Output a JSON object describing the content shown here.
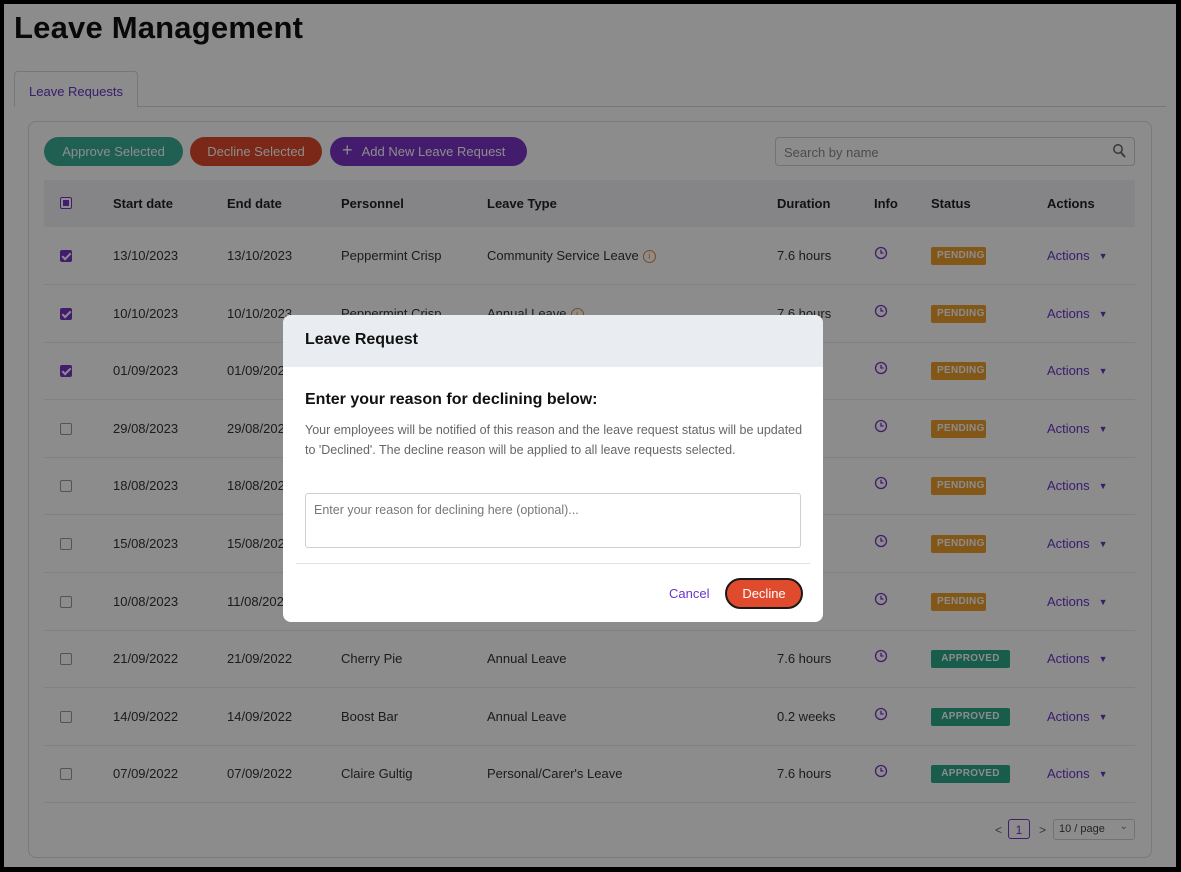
{
  "page": {
    "title": "Leave Management"
  },
  "tabs": [
    {
      "label": "Leave Requests"
    }
  ],
  "toolbar": {
    "approve_label": "Approve Selected",
    "decline_label": "Decline Selected",
    "add_label": "Add New Leave Request",
    "add_icon": "plus-icon",
    "search_placeholder": "Search by name",
    "search_icon": "search-icon"
  },
  "table": {
    "columns": [
      "Start date",
      "End date",
      "Personnel",
      "Leave Type",
      "Duration",
      "Info",
      "Status",
      "Actions"
    ],
    "rows": [
      {
        "checked": true,
        "start": "13/10/2023",
        "end": "13/10/2023",
        "personnel": "Peppermint Crisp",
        "type": "Community Service Leave",
        "warn": true,
        "duration": "7.6 hours",
        "status": "PENDING",
        "action": "Actions"
      },
      {
        "checked": true,
        "start": "10/10/2023",
        "end": "10/10/2023",
        "personnel": "Peppermint Crisp",
        "type": "Annual Leave",
        "warn": true,
        "duration": "7.6 hours",
        "status": "PENDING",
        "action": "Actions"
      },
      {
        "checked": true,
        "start": "01/09/2023",
        "end": "01/09/2023",
        "personnel": "",
        "type": "",
        "warn": false,
        "duration": "",
        "status": "PENDING",
        "action": "Actions"
      },
      {
        "checked": false,
        "start": "29/08/2023",
        "end": "29/08/2023",
        "personnel": "",
        "type": "",
        "warn": false,
        "duration": "",
        "status": "PENDING",
        "action": "Actions"
      },
      {
        "checked": false,
        "start": "18/08/2023",
        "end": "18/08/2023",
        "personnel": "",
        "type": "",
        "warn": false,
        "duration": "",
        "status": "PENDING",
        "action": "Actions"
      },
      {
        "checked": false,
        "start": "15/08/2023",
        "end": "15/08/2023",
        "personnel": "",
        "type": "",
        "warn": false,
        "duration": "",
        "status": "PENDING",
        "action": "Actions"
      },
      {
        "checked": false,
        "start": "10/08/2023",
        "end": "11/08/2023",
        "personnel": "",
        "type": "",
        "warn": false,
        "duration": "",
        "status": "PENDING",
        "action": "Actions"
      },
      {
        "checked": false,
        "start": "21/09/2022",
        "end": "21/09/2022",
        "personnel": "Cherry Pie",
        "type": "Annual Leave",
        "warn": false,
        "duration": "7.6 hours",
        "status": "APPROVED",
        "action": "Actions"
      },
      {
        "checked": false,
        "start": "14/09/2022",
        "end": "14/09/2022",
        "personnel": "Boost Bar",
        "type": "Annual Leave",
        "warn": false,
        "duration": "0.2 weeks",
        "status": "APPROVED",
        "action": "Actions"
      },
      {
        "checked": false,
        "start": "07/09/2022",
        "end": "07/09/2022",
        "personnel": "Claire Gultig",
        "type": "Personal/Carer's Leave",
        "warn": false,
        "duration": "7.6 hours",
        "status": "APPROVED",
        "action": "Actions"
      }
    ],
    "info_icon": "clock-icon",
    "warn_icon": "info-circle-icon",
    "action_icon": "caret-down-icon"
  },
  "pagination": {
    "prev": "<",
    "page": "1",
    "next": ">",
    "page_size": "10 / page"
  },
  "modal": {
    "title": "Leave Request",
    "heading": "Enter your reason for declining below:",
    "description": "Your employees will be notified of this reason and the leave request status will be updated to 'Declined'. The decline reason will be applied to all leave requests selected.",
    "input_placeholder": "Enter your reason for declining here (optional)...",
    "input_value": "",
    "cancel_label": "Cancel",
    "decline_label": "Decline"
  },
  "colors": {
    "accent": "#7b33c9",
    "approve": "#39b098",
    "decline": "#e04a2d",
    "pending": "#ef9e2a",
    "approved": "#2da889"
  }
}
